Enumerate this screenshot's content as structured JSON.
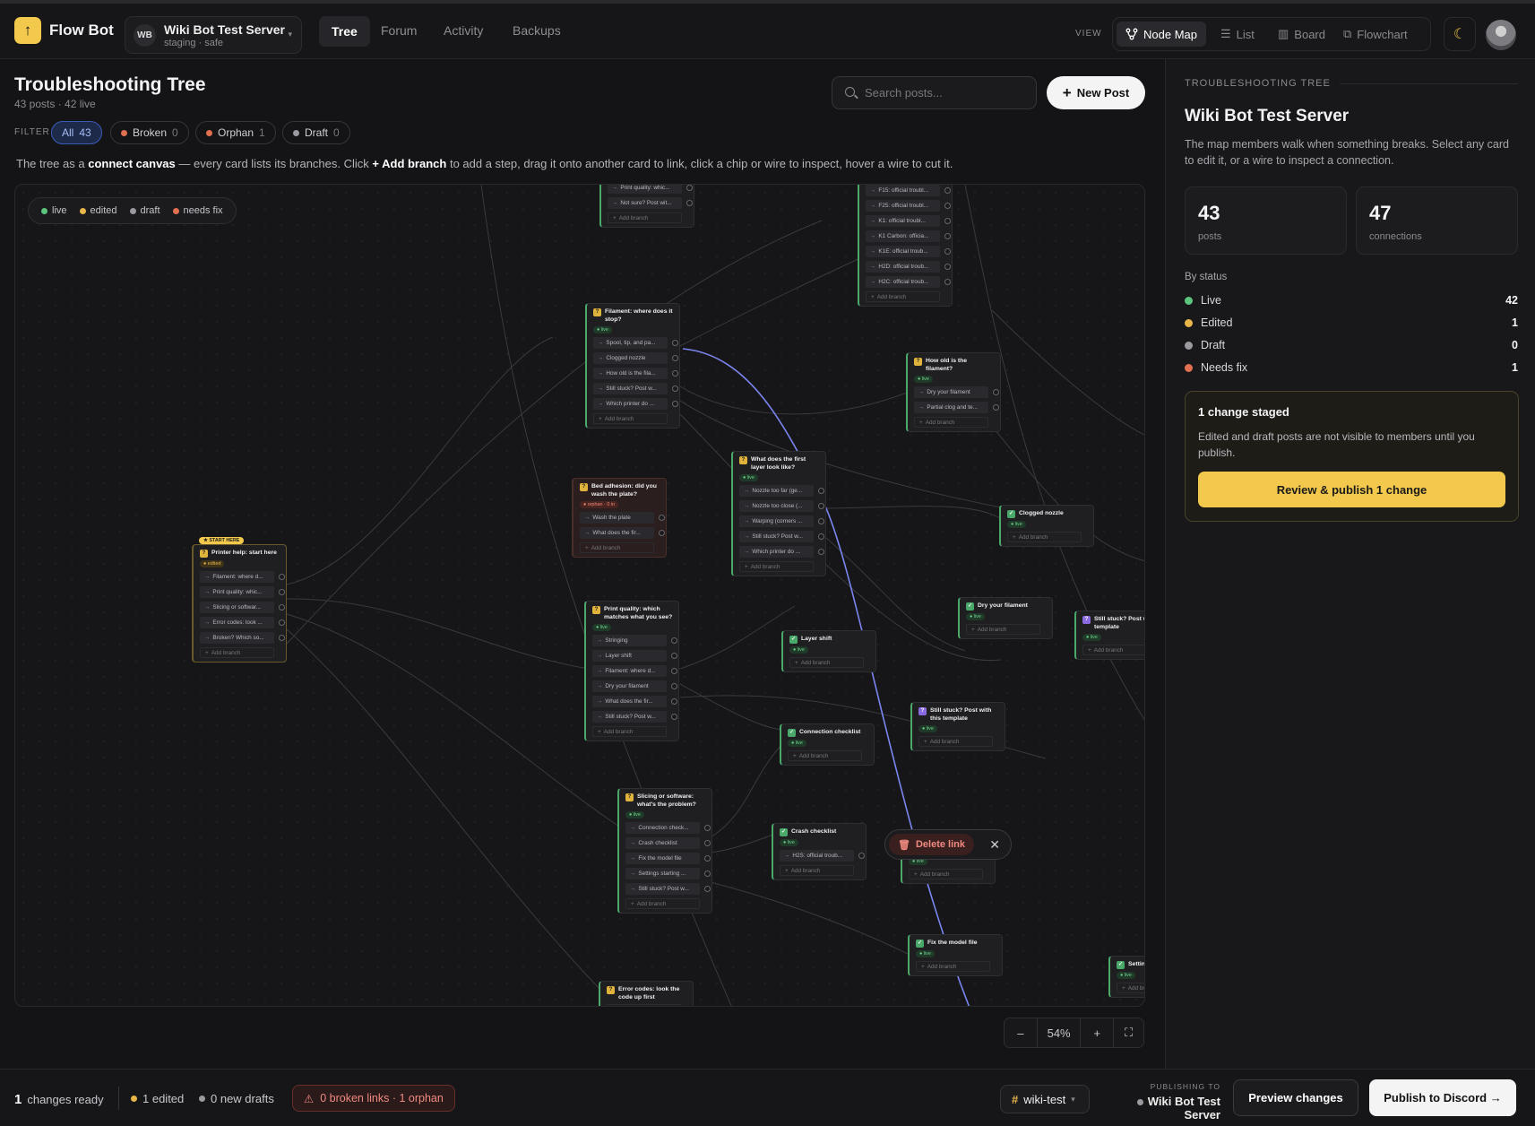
{
  "app": {
    "name": "Flow Bot",
    "logo_glyph": "↑"
  },
  "server": {
    "initials": "WB",
    "name": "Wiki Bot Test Server",
    "sub": "staging · safe"
  },
  "nav": {
    "tabs": [
      "Tree",
      "Forum",
      "Activity",
      "Backups"
    ],
    "active": "Tree"
  },
  "view": {
    "label": "VIEW",
    "options": [
      "Node Map",
      "List",
      "Board",
      "Flowchart"
    ],
    "active": "Node Map"
  },
  "page": {
    "title": "Troubleshooting Tree",
    "subtitle": "43 posts · 42 live"
  },
  "search": {
    "placeholder": "Search posts..."
  },
  "new_post": "New Post",
  "filter": {
    "label": "FILTER",
    "chips": [
      {
        "label": "All",
        "count": "43"
      },
      {
        "label": "Broken",
        "count": "0",
        "color": "#e0704f"
      },
      {
        "label": "Orphan",
        "count": "1",
        "color": "#e0704f"
      },
      {
        "label": "Draft",
        "count": "0",
        "color": "#9a9aa0"
      }
    ]
  },
  "hint": {
    "pre": "The tree as a ",
    "bold1": "connect canvas",
    "mid": " — every card lists its branches. Click ",
    "bold2": "+ Add branch",
    "post": " to add a step, drag it onto another card to link, click a chip or wire to inspect, hover a wire to cut it."
  },
  "legend": [
    {
      "label": "live",
      "color": "#5cc47c"
    },
    {
      "label": "edited",
      "color": "#e8b54a"
    },
    {
      "label": "draft",
      "color": "#9a9aa0"
    },
    {
      "label": "needs fix",
      "color": "#e0704f"
    }
  ],
  "add_branch": "Add branch",
  "start_here": "★ START HERE",
  "cards": {
    "top_a": {
      "title": "",
      "badge": "",
      "branches": [
        "Print quality: whic...",
        "Not sure? Post wit..."
      ]
    },
    "top_b": {
      "title": "",
      "badge": "",
      "branches": [
        "F15: official troubl...",
        "F25: official troubl...",
        "K1: official troubl...",
        "K1 Carbon: officia...",
        "K1E: official troub...",
        "H2D: official troub...",
        "H2C: official troub..."
      ]
    },
    "filament": {
      "title": "Filament: where does it stop?",
      "badge": "live",
      "branches": [
        "Spool, tip, and pa...",
        "Clogged nozzle",
        "How old is the fila...",
        "Still stuck? Post w...",
        "Which printer do ..."
      ]
    },
    "how_old": {
      "title": "How old is the filament?",
      "badge": "live",
      "branches": [
        "Dry your filament",
        "Partial clog and te..."
      ]
    },
    "first_layer": {
      "title": "What does the first layer look like?",
      "badge": "live",
      "branches": [
        "Nozzle too far (ge...",
        "Nozzle too close (...",
        "Warping (corners ...",
        "Still stuck? Post w...",
        "Which printer do ..."
      ]
    },
    "bed": {
      "title": "Bed adhesion: did you wash the plate?",
      "badge": "orphan · 0 in",
      "branches": [
        "Wash the plate",
        "What does the fir..."
      ]
    },
    "clogged": {
      "title": "Clogged nozzle",
      "badge": "live",
      "branches": []
    },
    "start": {
      "title": "Printer help: start here",
      "badge": "edited",
      "branches": [
        "Filament: where d...",
        "Print quality: whic...",
        "Slicing or softwar...",
        "Error codes: look ...",
        "Broken? Which so..."
      ]
    },
    "print_quality": {
      "title": "Print quality: which matches what you see?",
      "badge": "live",
      "branches": [
        "Stringing",
        "Layer shift",
        "Filament: where d...",
        "Dry your filament",
        "What does the fir...",
        "Still stuck? Post w..."
      ]
    },
    "layer_shift": {
      "title": "Layer shift",
      "badge": "live",
      "branches": []
    },
    "dry": {
      "title": "Dry your filament",
      "badge": "live",
      "branches": []
    },
    "still_stuck_r": {
      "title": "Still stuck? Post w this template",
      "badge": "live",
      "branches": []
    },
    "still_stuck": {
      "title": "Still stuck? Post with this template",
      "badge": "live",
      "branches": []
    },
    "connection": {
      "title": "Connection checklist",
      "badge": "live",
      "branches": []
    },
    "slicing": {
      "title": "Slicing or software: what's the problem?",
      "badge": "live",
      "branches": [
        "Connection check...",
        "Crash checklist",
        "Fix the model file",
        "Settings starting ...",
        "Still stuck? Post w..."
      ]
    },
    "crash": {
      "title": "Crash checklist",
      "badge": "live",
      "branches": [
        "H2S: official troub..."
      ]
    },
    "hidden": {
      "title": "",
      "badge": "live",
      "branches": []
    },
    "fix_model": {
      "title": "Fix the model file",
      "badge": "live",
      "branches": []
    },
    "settings": {
      "title": "Settin",
      "badge": "live",
      "branches": []
    },
    "error": {
      "title": "Error codes: look the code up first",
      "badge": "",
      "branches": []
    }
  },
  "delete_link": {
    "label": "Delete link"
  },
  "zoom": {
    "minus": "–",
    "level": "54%",
    "plus": "+"
  },
  "sidebar": {
    "label": "TROUBLESHOOTING TREE",
    "title": "Wiki Bot Test Server",
    "desc": "The map members walk when something breaks. Select any card to edit it, or a wire to inspect a connection.",
    "stats": [
      {
        "num": "43",
        "label": "posts"
      },
      {
        "num": "47",
        "label": "connections"
      }
    ],
    "by_status": "By status",
    "status": [
      {
        "label": "Live",
        "value": "42",
        "color": "#5cc47c"
      },
      {
        "label": "Edited",
        "value": "1",
        "color": "#e8b54a"
      },
      {
        "label": "Draft",
        "value": "0",
        "color": "#9a9aa0"
      },
      {
        "label": "Needs fix",
        "value": "1",
        "color": "#e0704f"
      }
    ],
    "staged": {
      "title": "1 change staged",
      "text": "Edited and draft posts are not visible to members until you publish.",
      "button": "Review & publish 1 change"
    }
  },
  "footer": {
    "changes_num": "1",
    "changes_label": "changes ready",
    "edited": "1 edited",
    "drafts": "0 new drafts",
    "broken": "0 broken links · 1 orphan",
    "channel": "wiki-test",
    "publishing_to_label": "PUBLISHING TO",
    "publishing_to": "Wiki Bot Test Server",
    "preview": "Preview changes",
    "publish": "Publish to Discord →"
  }
}
